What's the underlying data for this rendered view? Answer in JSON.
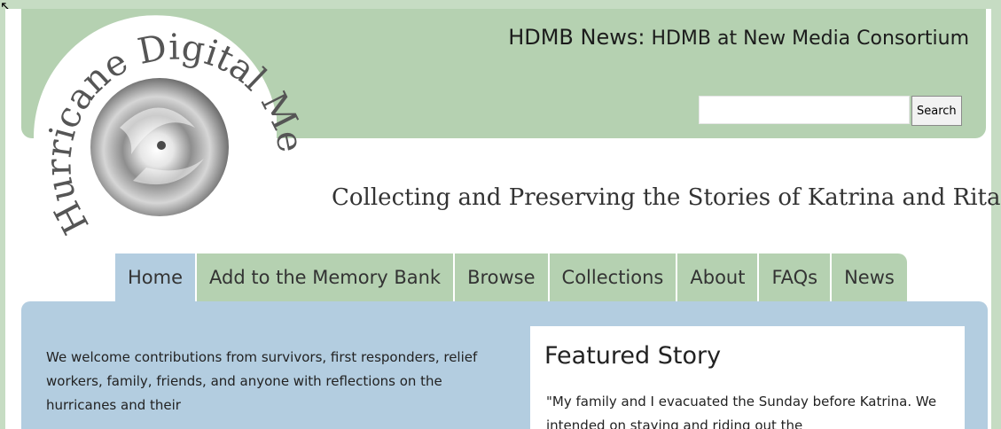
{
  "header": {
    "news_label": "HDMB News:",
    "news_text": "HDMB at New Media Consortium",
    "search_placeholder": "",
    "search_button": "Search",
    "logo_text": "Hurricane Digital Memory Bank",
    "tagline": "Collecting and Preserving the Stories of Katrina and Rita"
  },
  "nav": {
    "items": [
      {
        "label": "Home",
        "active": true
      },
      {
        "label": "Add to the Memory Bank"
      },
      {
        "label": "Browse"
      },
      {
        "label": "Collections"
      },
      {
        "label": "About"
      },
      {
        "label": "FAQs"
      },
      {
        "label": "News"
      }
    ]
  },
  "main": {
    "welcome_text": "We welcome contributions from survivors, first responders, relief workers, family, friends, and anyone with reflections on the hurricanes and their",
    "featured_title": "Featured Story",
    "featured_text": "\"My family and I evacuated the Sunday before Katrina. We intended on staying and riding out the"
  },
  "colors": {
    "header_green": "#b5d1b1",
    "content_blue": "#b3cde0"
  }
}
